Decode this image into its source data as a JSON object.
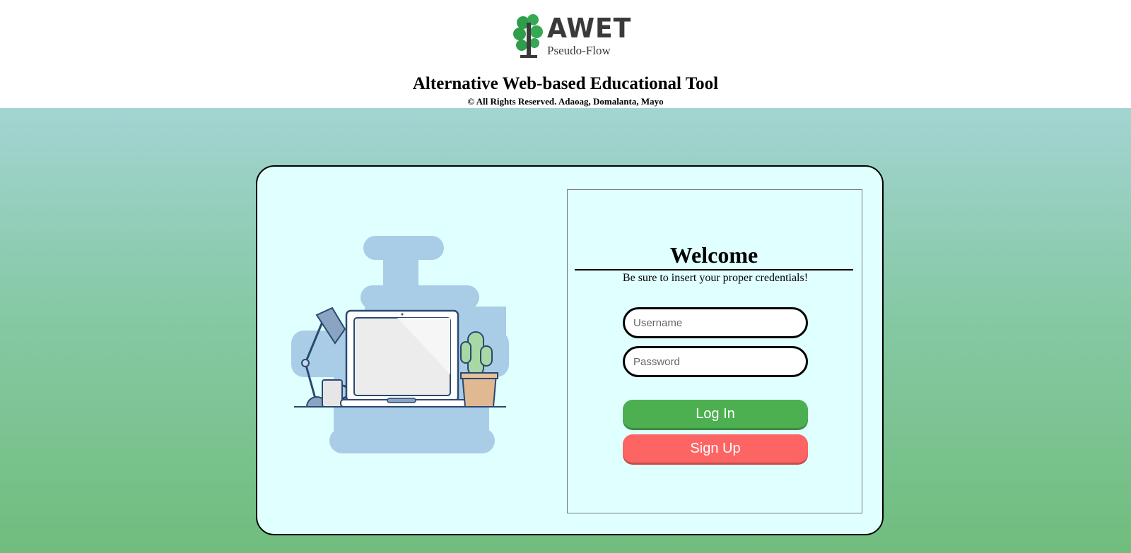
{
  "header": {
    "logo_word": "AWET",
    "logo_sub": "Pseudo-Flow",
    "title": "Alternative Web-based Educational Tool",
    "copyright": "© All Rights Reserved. Adaoag, Domalanta, Mayo"
  },
  "login": {
    "heading": "Welcome",
    "subtitle": "Be sure to insert your proper credentials!",
    "username_placeholder": "Username",
    "password_placeholder": "Password",
    "username_value": "",
    "password_value": "",
    "login_label": "Log In",
    "signup_label": "Sign Up"
  },
  "colors": {
    "login_button": "#4caf50",
    "signup_button": "#fd6464",
    "card_background": "#e0ffff"
  }
}
